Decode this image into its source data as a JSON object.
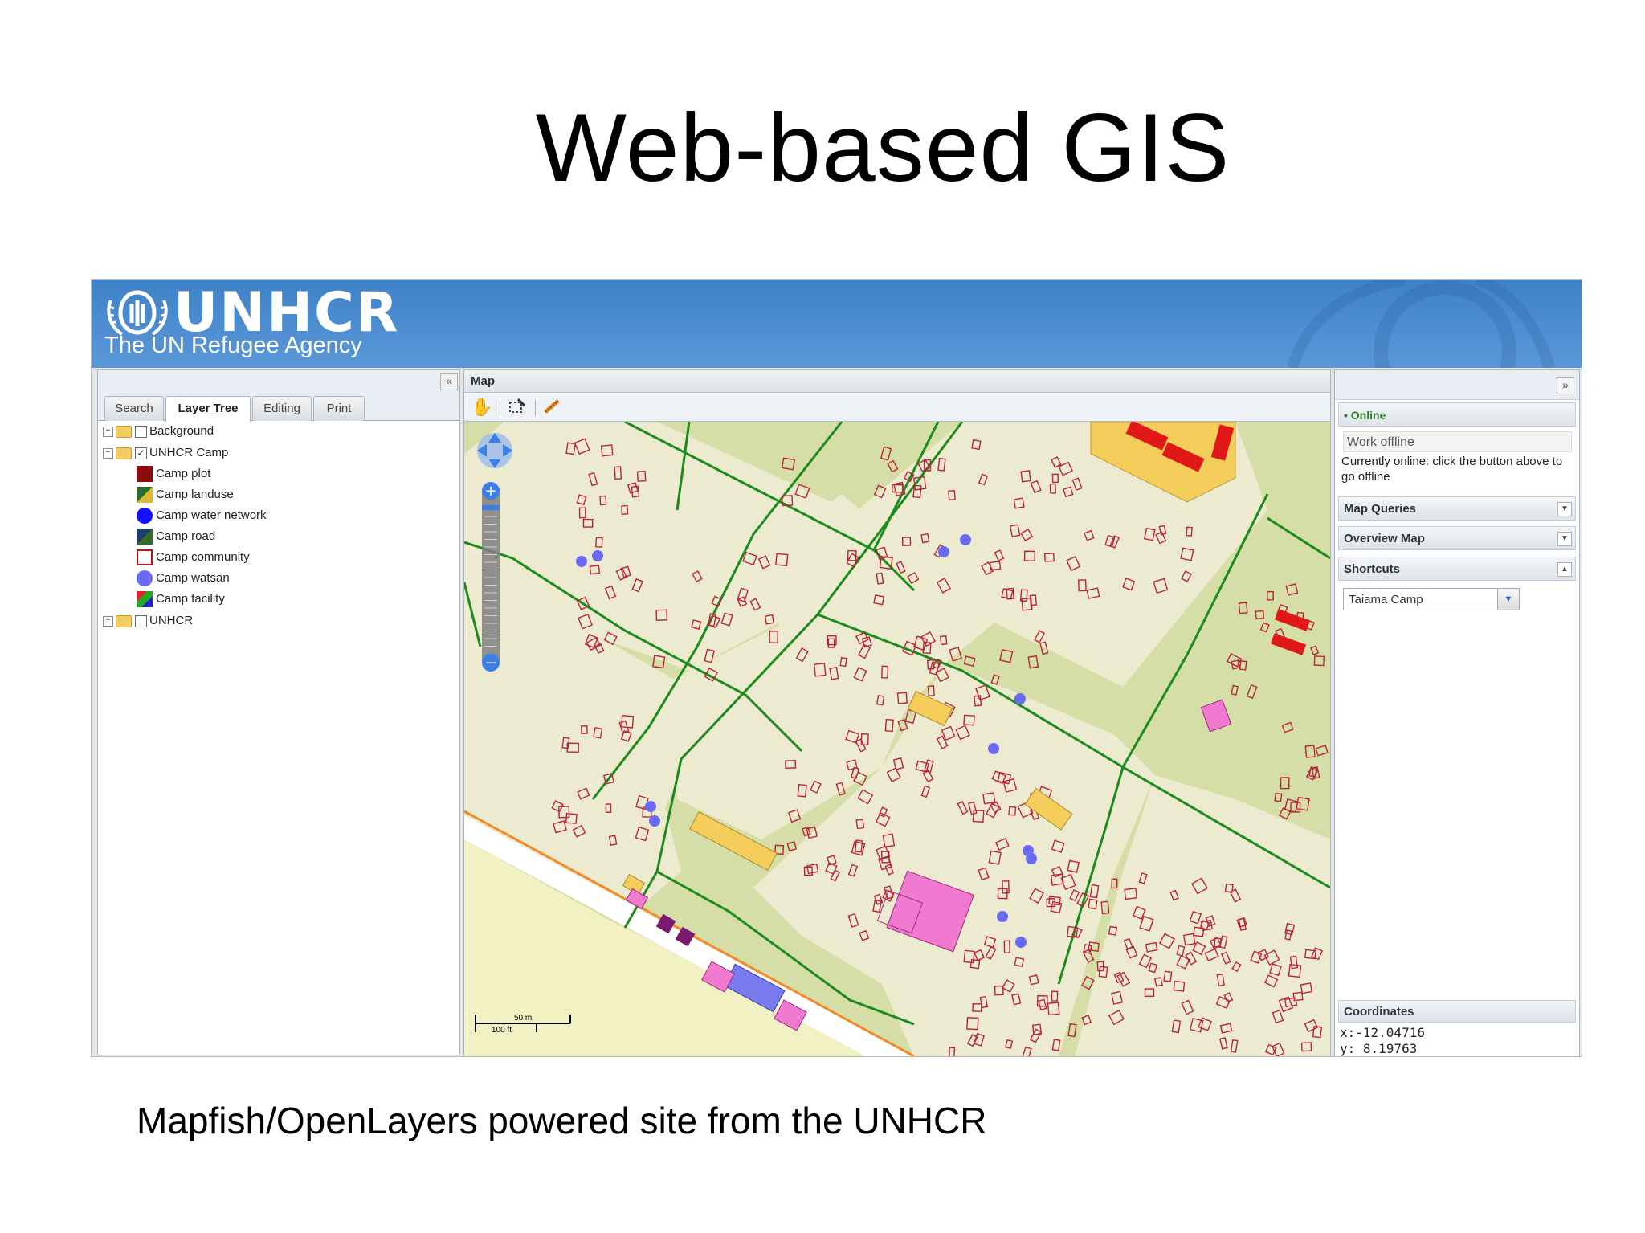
{
  "slide": {
    "title": "Web-based GIS",
    "caption": "Mapfish/OpenLayers powered site from the UNHCR"
  },
  "app": {
    "logo_text": "UNHCR",
    "logo_subtitle": "The UN Refugee Agency",
    "brand_color": "#4a8bd0"
  },
  "left_panel": {
    "collapse_glyph": "«",
    "tabs": [
      {
        "label": "Search",
        "active": false
      },
      {
        "label": "Layer Tree",
        "active": true
      },
      {
        "label": "Editing",
        "active": false
      },
      {
        "label": "Print",
        "active": false
      }
    ],
    "tree": [
      {
        "label": "Background",
        "expander": "+",
        "checked": false
      },
      {
        "label": "UNHCR Camp",
        "expander": "−",
        "checked": true
      },
      {
        "label": "Camp plot",
        "symbol": "dark-red-square"
      },
      {
        "label": "Camp landuse",
        "symbol": "multicolor-square"
      },
      {
        "label": "Camp water network",
        "symbol": "blue-circle"
      },
      {
        "label": "Camp road",
        "symbol": "road-square"
      },
      {
        "label": "Camp community",
        "symbol": "red-outline-square"
      },
      {
        "label": "Camp watsan",
        "symbol": "light-blue-circle"
      },
      {
        "label": "Camp facility",
        "symbol": "facility-square"
      },
      {
        "label": "UNHCR",
        "expander": "+",
        "checked": false
      }
    ]
  },
  "map": {
    "title": "Map",
    "tools": [
      "pan-hand-icon",
      "zoom-box-icon",
      "measure-icon"
    ],
    "scale_top": "50 m",
    "scale_bottom": "100 ft"
  },
  "right_panel": {
    "collapse_glyph": "»",
    "online_label": "• Online",
    "work_offline_label": "Work offline",
    "online_message": "Currently online: click the button above to go offline",
    "sections": [
      {
        "label": "Map Queries",
        "state": "collapsed"
      },
      {
        "label": "Overview Map",
        "state": "collapsed"
      },
      {
        "label": "Shortcuts",
        "state": "expanded"
      }
    ],
    "shortcut_selected": "Taiama Camp",
    "coordinates_label": "Coordinates",
    "coord_x": "x:-12.04716",
    "coord_y": "y: 8.19763"
  }
}
